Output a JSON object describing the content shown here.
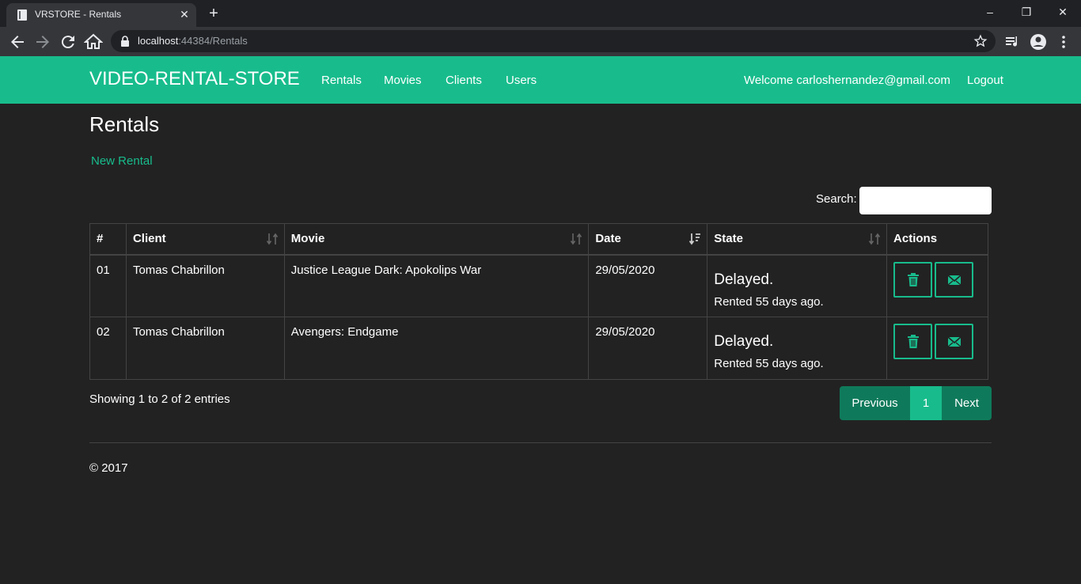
{
  "browser": {
    "tab_title": "VRSTORE - Rentals",
    "tab_close": "✕",
    "new_tab": "+",
    "url_host": "localhost",
    "url_rest": ":44384/Rentals",
    "minimize": "–",
    "maximize": "❐",
    "close": "✕"
  },
  "navbar": {
    "brand": "VIDEO-RENTAL-STORE",
    "links": [
      "Rentals",
      "Movies",
      "Clients",
      "Users"
    ],
    "welcome": "Welcome carloshernandez@gmail.com",
    "logout": "Logout",
    "color": "#18bc8c"
  },
  "page": {
    "title": "Rentals",
    "new_rental": "New Rental",
    "search_label": "Search:",
    "search_value": ""
  },
  "table": {
    "headers": [
      "#",
      "Client",
      "Movie",
      "Date",
      "State",
      "Actions"
    ],
    "rows": [
      {
        "num": "01",
        "client": "Tomas Chabrillon",
        "movie": "Justice League Dark: Apokolips War",
        "date": "29/05/2020",
        "state": "Delayed.",
        "state_detail": "Rented 55 days ago."
      },
      {
        "num": "02",
        "client": "Tomas Chabrillon",
        "movie": "Avengers: Endgame",
        "date": "29/05/2020",
        "state": "Delayed.",
        "state_detail": "Rented 55 days ago."
      }
    ]
  },
  "pagination": {
    "info": "Showing 1 to 2 of 2 entries",
    "previous": "Previous",
    "current": "1",
    "next": "Next"
  },
  "footer": {
    "text": "© 2017"
  },
  "icons": {
    "delete": "trash-icon",
    "email": "envelope-icon",
    "sort": "sort-icon"
  }
}
